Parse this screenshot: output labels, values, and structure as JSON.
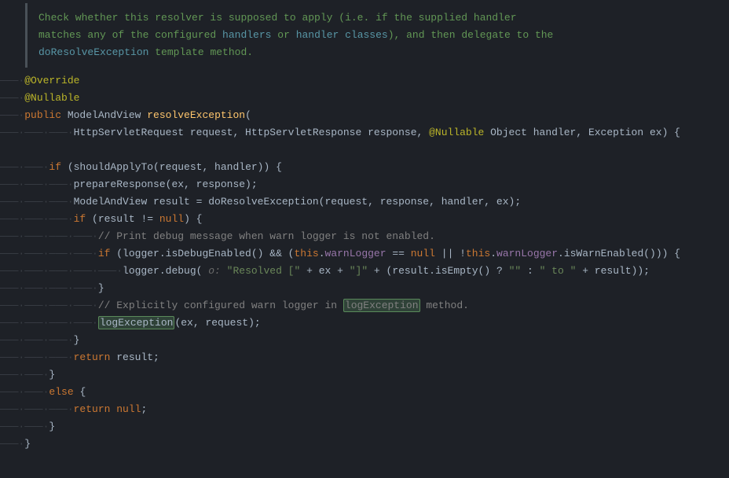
{
  "doc": {
    "l1a": "Check whether this resolver is supposed to apply (i.e. if the supplied handler",
    "l2a": "matches any of the configured ",
    "l2b": "handlers",
    "l2c": " or ",
    "l2d": "handler classes",
    "l2e": "), and then delegate to the",
    "l3a": "doResolveException",
    "l3b": " template method."
  },
  "line01": {
    "ann": "@Override"
  },
  "line02": {
    "ann": "@Nullable"
  },
  "line03": {
    "kw": "public ",
    "type": "ModelAndView ",
    "method": "resolveException",
    "p": "("
  },
  "line04": {
    "a": "HttpServletRequest request, HttpServletResponse response, ",
    "ann": "@Nullable",
    "b": " Object handler, Exception ex) {"
  },
  "line05": {
    "blank": ""
  },
  "line06": {
    "kw": "if ",
    "a": "(shouldApplyTo(request, handler)) {"
  },
  "line07": {
    "a": "prepareResponse(ex, response);"
  },
  "line08": {
    "a": "ModelAndView result = doResolveException(request, response, handler, ex);"
  },
  "line09": {
    "kw": "if ",
    "a": "(result != ",
    "nk": "null",
    "b": ") {"
  },
  "line10": {
    "c": "// Print debug message when warn logger is not enabled."
  },
  "line11": {
    "kw": "if ",
    "a": "(logger.isDebugEnabled() && (",
    "kw2": "this",
    "b": ".",
    "f1": "warnLogger",
    "c": " == ",
    "nk": "null",
    "d": " || !",
    "kw3": "this",
    "e": ".",
    "f2": "warnLogger",
    "g": ".isWarnEnabled())) {"
  },
  "line12": {
    "a": "logger.debug(",
    "hint": " o: ",
    "s1": "\"Resolved [\"",
    "b": " + ex + ",
    "s2": "\"]\"",
    "c": " + (result.isEmpty() ? ",
    "s3": "\"\"",
    "d": " : ",
    "s4": "\" to \"",
    "e": " + result));"
  },
  "line13": {
    "a": "}"
  },
  "line14": {
    "c1": "// Explicitly configured warn logger in ",
    "hl": "logException",
    "c2": " method."
  },
  "line15": {
    "hl": "logException",
    "a": "(ex, request);"
  },
  "line16": {
    "a": "}"
  },
  "line17": {
    "kw": "return ",
    "a": "result;"
  },
  "line18": {
    "a": "}"
  },
  "line19": {
    "kw": "else ",
    "a": "{"
  },
  "line20": {
    "kw": "return ",
    "nk": "null",
    "a": ";"
  },
  "line21": {
    "a": "}"
  },
  "line22": {
    "a": "}"
  }
}
